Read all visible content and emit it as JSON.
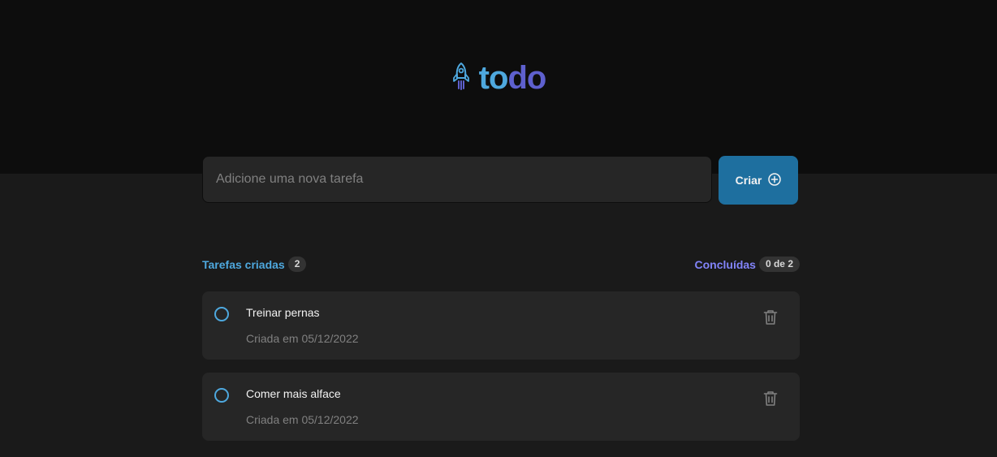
{
  "app": {
    "logo_part_1": "to",
    "logo_part_2": "do",
    "logo_icon": "rocket-icon"
  },
  "form": {
    "placeholder": "Adicione uma nova tarefa",
    "create_label": "Criar",
    "create_icon": "plus-circle-icon"
  },
  "counters": {
    "created_label": "Tarefas criadas",
    "created_count": "2",
    "done_label": "Concluídas",
    "done_count": "0 de 2"
  },
  "tasks": [
    {
      "title": "Treinar pernas",
      "date": "Criada em 05/12/2022",
      "completed": false
    },
    {
      "title": "Comer mais alface",
      "date": "Criada em 05/12/2022",
      "completed": false
    }
  ],
  "colors": {
    "blue": "#4ea8de",
    "purple": "#5e60ce",
    "purple_light": "#8284fa",
    "button": "#1e6f9f",
    "header_bg": "#0d0d0d",
    "page_bg": "#1a1a1a",
    "card_bg": "#262626"
  }
}
